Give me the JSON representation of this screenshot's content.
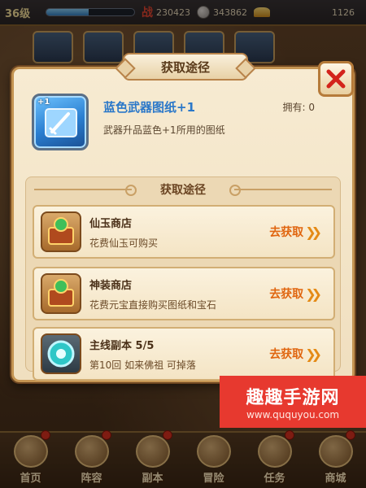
{
  "topbar": {
    "level": "36级",
    "exp_fraction": 0.48,
    "power": "230423",
    "silver": "343862",
    "gold": "1126"
  },
  "dialog": {
    "title": "获取途径",
    "item": {
      "name": "蓝色武器图纸+1",
      "badge": "+1",
      "owned_label": "拥有: 0",
      "description": "武器升品蓝色+1所用的图纸"
    },
    "sources_title": "获取途径",
    "sources": [
      {
        "title": "仙玉商店",
        "desc": "花费仙玉可购买",
        "button": "去获取"
      },
      {
        "title": "神装商店",
        "desc": "花费元宝直接购买图纸和宝石",
        "button": "去获取"
      },
      {
        "title": "主线副本  5/5",
        "desc": "第10回 如来佛祖 可掉落",
        "button": "去获取"
      }
    ]
  },
  "bottom_nav": [
    {
      "label": "首页"
    },
    {
      "label": "阵容"
    },
    {
      "label": "副本"
    },
    {
      "label": "冒险"
    },
    {
      "label": "任务"
    },
    {
      "label": "商城"
    }
  ],
  "watermark": {
    "title": "趣趣手游网",
    "url": "www.ququyou.com"
  },
  "colors": {
    "accent_blue": "#2b78c9",
    "button_orange": "#e0650f",
    "watermark_red": "#e7392f"
  }
}
